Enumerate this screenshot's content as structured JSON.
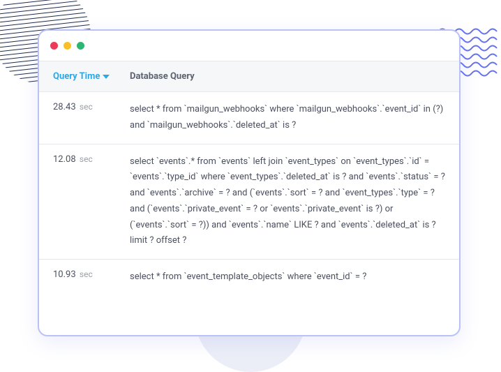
{
  "header": {
    "time_label": "Query Time",
    "query_label": "Database Query"
  },
  "sec_unit": "sec",
  "rows": [
    {
      "time": "28.43",
      "query": "select * from `mailgun_webhooks` where `mailgun_webhooks`.`event_id` in (?) and `mailgun_webhooks`.`deleted_at` is ?"
    },
    {
      "time": "12.08",
      "query": "select `events`.* from `events` left join `event_types` on `event_types`.`id` = `events`.`type_id` where `event_types`.`deleted_at` is ? and `events`.`status` = ? and `events`.`archive` = ? and (`events`.`sort` = ? and `event_types`.`type` = ? and (`events`.`private_event` = ? or `events`.`private_event` is ?) or (`events`.`sort` = ?)) and `events`.`name` LIKE ? and `events`.`deleted_at` is ? limit ? offset ?"
    },
    {
      "time": "10.93",
      "query": "select * from `event_template_objects` where `event_id` = ?"
    }
  ]
}
